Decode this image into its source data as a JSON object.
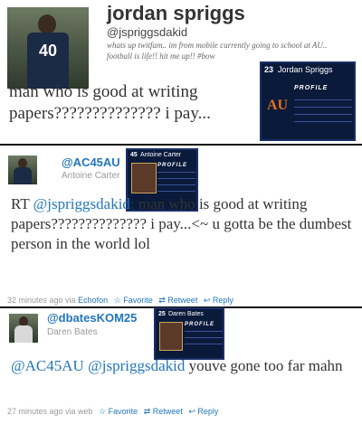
{
  "tweet1": {
    "name": "jordan spriggs",
    "handle": "@jspriggsdakid",
    "bio": "whats up twitfam.. im from mobile currently going to school at AU.. football is life!! hit me up!! #bow",
    "text": "man who is good at writing papers?????????????? i pay...",
    "jersey_number": "40",
    "card": {
      "number": "23",
      "name": "Jordan Spriggs",
      "profile": "PROFILE",
      "logo": "AU"
    }
  },
  "tweet2": {
    "handle": "@AC45AU",
    "name": "Antoine Carter",
    "text_prefix": "RT ",
    "mention": "@jspriggsdakid",
    "text_rest": ": man who is good at writing papers?????????????? i pay...<~ u gotta be the dumbest person in the world lol",
    "time": "32 minutes ago via",
    "via": "Echofon",
    "favorite": "Favorite",
    "retweet": "Retweet",
    "reply": "Reply",
    "card": {
      "number": "45",
      "name": "Antoine Carter",
      "profile": "PROFILE"
    }
  },
  "tweet3": {
    "handle": "@dbatesKOM25",
    "name": "Daren Bates",
    "mention1": "@AC45AU",
    "mention2": "@jspriggsdakid",
    "text_rest": " youve gone too far mahn",
    "time": "27 minutes ago via web",
    "favorite": "Favorite",
    "retweet": "Retweet",
    "reply": "Reply",
    "card": {
      "number": "25",
      "name": "Daren Bates",
      "profile": "PROFILE"
    }
  }
}
